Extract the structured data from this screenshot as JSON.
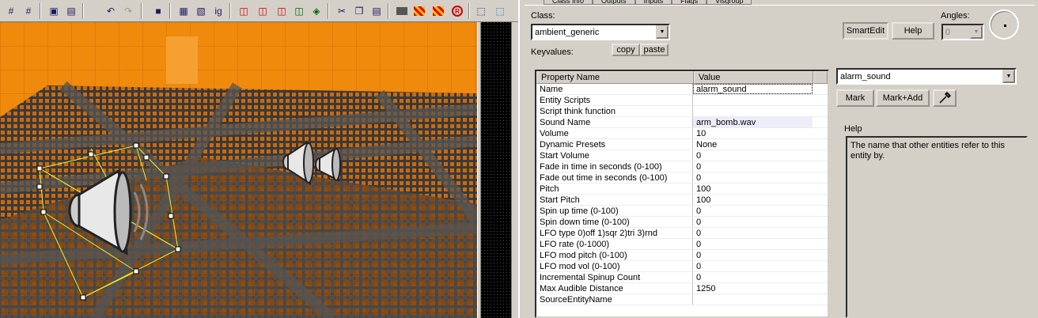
{
  "toolbar": {
    "icons": [
      "grid-icon",
      "grid-dots-icon",
      "group-icon",
      "ungroup-icon",
      "undo-icon",
      "redo-icon",
      "cube-icon",
      "select-icon",
      "texture-icon",
      "ignore-group-icon",
      "carve-icon",
      "hollow-icon",
      "clip-icon",
      "vertex-icon",
      "visgroup-icon",
      "cut-icon",
      "copy-icon",
      "paste-icon",
      "texture-lock-icon",
      "hatch-icon",
      "hatch2-icon",
      "run-icon",
      "toolbox-icon",
      "selection-icon"
    ],
    "ig_label": "ig",
    "run_label": "R"
  },
  "tabs": [
    "Class Info",
    "Outputs",
    "Inputs",
    "Flags",
    "Visgroup"
  ],
  "class": {
    "label": "Class:",
    "value": "ambient_generic"
  },
  "keyvalues": {
    "label": "Keyvalues:",
    "copy": "copy",
    "paste": "paste"
  },
  "buttons": {
    "smartedit": "SmartEdit",
    "help": "Help",
    "mark": "Mark",
    "mark_add": "Mark+Add"
  },
  "angles": {
    "label": "Angles:",
    "value": "0"
  },
  "value_combo": {
    "value": "alarm_sound"
  },
  "grid": {
    "headers": [
      "Property Name",
      "Value"
    ],
    "rows": [
      {
        "name": "Name",
        "value": "alarm_sound"
      },
      {
        "name": "Entity Scripts",
        "value": ""
      },
      {
        "name": "Script think function",
        "value": ""
      },
      {
        "name": "Sound Name",
        "value": "arm_bomb.wav"
      },
      {
        "name": "Volume",
        "value": "10"
      },
      {
        "name": "Dynamic Presets",
        "value": "None"
      },
      {
        "name": "Start Volume",
        "value": "0"
      },
      {
        "name": "Fade in time in seconds (0-100)",
        "value": "0"
      },
      {
        "name": "Fade out time in seconds (0-100)",
        "value": "0"
      },
      {
        "name": "Pitch",
        "value": "100"
      },
      {
        "name": "Start Pitch",
        "value": "100"
      },
      {
        "name": "Spin up time (0-100)",
        "value": "0"
      },
      {
        "name": "Spin down time (0-100)",
        "value": "0"
      },
      {
        "name": "LFO type 0)off 1)sqr 2)tri 3)rnd",
        "value": "0"
      },
      {
        "name": "LFO rate (0-1000)",
        "value": "0"
      },
      {
        "name": "LFO mod pitch (0-100)",
        "value": "0"
      },
      {
        "name": "LFO mod vol (0-100)",
        "value": "0"
      },
      {
        "name": "Incremental Spinup Count",
        "value": "0"
      },
      {
        "name": "Max Audible Distance",
        "value": "1250"
      },
      {
        "name": "SourceEntityName",
        "value": ""
      }
    ]
  },
  "help": {
    "label": "Help",
    "text": "The name that other entities refer to this entity by."
  },
  "colors": {
    "floor_orange": "#e8860a",
    "selection_yellow": "#f0f020"
  }
}
